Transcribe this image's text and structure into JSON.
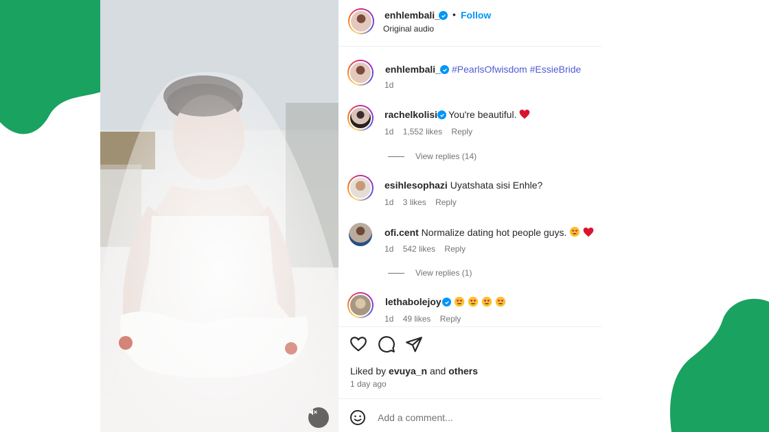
{
  "theme": {
    "accent": "#0095f6",
    "blob_color": "#1aa260",
    "hashtag_color": "#4f5bd5",
    "heart_color": "#ed1c3a"
  },
  "video": {
    "muted": true,
    "icon": "speaker-muted-icon"
  },
  "header": {
    "username": "enhlembali_",
    "verified": true,
    "separator": "•",
    "follow_label": "Follow",
    "audio_label": "Original audio"
  },
  "caption": {
    "username": "enhlembali_",
    "verified": true,
    "text": "#PearlsOfwisdom #EssieBride",
    "time": "1d"
  },
  "comments": [
    {
      "username": "rachelkolisi",
      "verified": true,
      "text": "You're beautiful.",
      "emoji": [
        "red-heart"
      ],
      "time": "1d",
      "likes": "1,552 likes",
      "reply": "Reply",
      "view_replies": "View replies (14)"
    },
    {
      "username": "esihlesophazi",
      "verified": false,
      "text": "Uyatshata sisi Enhle?",
      "emoji": [],
      "time": "1d",
      "likes": "3 likes",
      "reply": "Reply",
      "view_replies": ""
    },
    {
      "username": "ofi.cent",
      "verified": false,
      "text": "Normalize dating hot people guys.",
      "emoji": [
        "heart-eyes",
        "red-heart"
      ],
      "time": "1d",
      "likes": "542 likes",
      "reply": "Reply",
      "view_replies": "View replies (1)"
    },
    {
      "username": "lethabolejoy",
      "verified": true,
      "text": "",
      "emoji": [
        "heart-eyes",
        "heart-eyes",
        "heart-eyes",
        "heart-eyes"
      ],
      "time": "1d",
      "likes": "49 likes",
      "reply": "Reply",
      "view_replies": ""
    }
  ],
  "actions": {
    "like_icon": "heart-outline-icon",
    "comment_icon": "comment-bubble-icon",
    "share_icon": "paper-plane-icon"
  },
  "likes_summary": {
    "prefix": "Liked by",
    "user": "evuya_n",
    "middle": "and",
    "others": "others"
  },
  "time_ago": "1 day ago",
  "add_comment": {
    "placeholder": "Add a comment...",
    "icon": "smiley-icon"
  }
}
